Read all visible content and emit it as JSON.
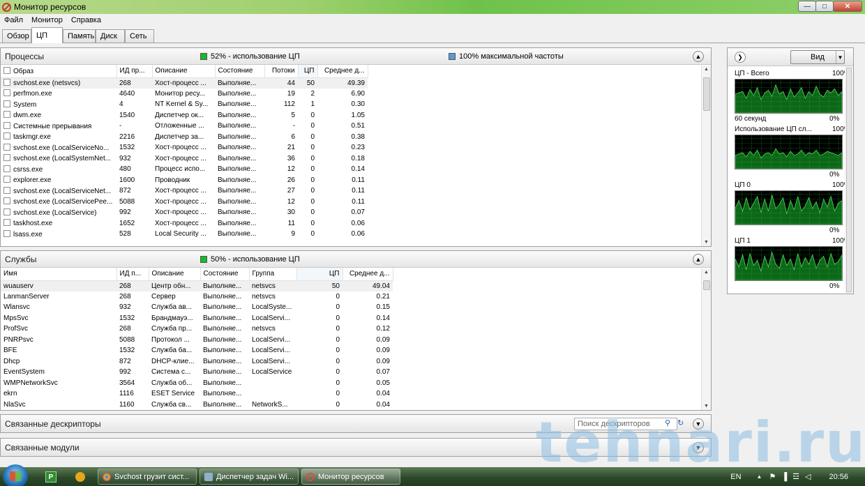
{
  "window": {
    "title": "Монитор ресурсов"
  },
  "menu": [
    "Файл",
    "Монитор",
    "Справка"
  ],
  "tabs": [
    "Обзор",
    "ЦП",
    "Память",
    "Диск",
    "Сеть"
  ],
  "processes": {
    "title": "Процессы",
    "cpu_usage_label": "52% - использование ЦП",
    "freq_label": "100% максимальной частоты",
    "usage_color": "#19b92e",
    "freq_color": "#5b9bd5",
    "columns": [
      "Образ",
      "ИД пр...",
      "Описание",
      "Состояние",
      "Потоки",
      "ЦП",
      "Среднее д..."
    ],
    "rows": [
      [
        "svchost.exe (netsvcs)",
        "268",
        "Хост-процесс ...",
        "Выполняе...",
        "44",
        "50",
        "49.39"
      ],
      [
        "perfmon.exe",
        "4640",
        "Монитор ресу...",
        "Выполняе...",
        "19",
        "2",
        "6.90"
      ],
      [
        "System",
        "4",
        "NT Kernel & Sy...",
        "Выполняе...",
        "112",
        "1",
        "0.30"
      ],
      [
        "dwm.exe",
        "1540",
        "Диспетчер ок...",
        "Выполняе...",
        "5",
        "0",
        "1.05"
      ],
      [
        "Системные прерывания",
        "-",
        "Отложенные ...",
        "Выполняе...",
        "-",
        "0",
        "0.51"
      ],
      [
        "taskmgr.exe",
        "2216",
        "Диспетчер за...",
        "Выполняе...",
        "6",
        "0",
        "0.38"
      ],
      [
        "svchost.exe (LocalServiceNo...",
        "1532",
        "Хост-процесс ...",
        "Выполняе...",
        "21",
        "0",
        "0.23"
      ],
      [
        "svchost.exe (LocalSystemNet...",
        "932",
        "Хост-процесс ...",
        "Выполняе...",
        "36",
        "0",
        "0.18"
      ],
      [
        "csrss.exe",
        "480",
        "Процесс испо...",
        "Выполняе...",
        "12",
        "0",
        "0.14"
      ],
      [
        "explorer.exe",
        "1600",
        "Проводник",
        "Выполняе...",
        "26",
        "0",
        "0.11"
      ],
      [
        "svchost.exe (LocalServiceNet...",
        "872",
        "Хост-процесс ...",
        "Выполняе...",
        "27",
        "0",
        "0.11"
      ],
      [
        "svchost.exe (LocalServicePee...",
        "5088",
        "Хост-процесс ...",
        "Выполняе...",
        "12",
        "0",
        "0.11"
      ],
      [
        "svchost.exe (LocalService)",
        "992",
        "Хост-процесс ...",
        "Выполняе...",
        "30",
        "0",
        "0.07"
      ],
      [
        "taskhost.exe",
        "1652",
        "Хост-процесс ...",
        "Выполняе...",
        "11",
        "0",
        "0.06"
      ],
      [
        "lsass.exe",
        "528",
        "Local Security ...",
        "Выполняе...",
        "9",
        "0",
        "0.06"
      ]
    ]
  },
  "services": {
    "title": "Службы",
    "cpu_usage_label": "50% - использование ЦП",
    "columns": [
      "Имя",
      "ИД п...",
      "Описание",
      "Состояние",
      "Группа",
      "ЦП",
      "Среднее д..."
    ],
    "rows": [
      [
        "wuauserv",
        "268",
        "Центр обн...",
        "Выполняе...",
        "netsvcs",
        "50",
        "49.04"
      ],
      [
        "LanmanServer",
        "268",
        "Сервер",
        "Выполняе...",
        "netsvcs",
        "0",
        "0.21"
      ],
      [
        "Wlansvc",
        "932",
        "Служба ав...",
        "Выполняе...",
        "LocalSyste...",
        "0",
        "0.15"
      ],
      [
        "MpsSvc",
        "1532",
        "Брандмауэ...",
        "Выполняе...",
        "LocalServi...",
        "0",
        "0.14"
      ],
      [
        "ProfSvc",
        "268",
        "Служба пр...",
        "Выполняе...",
        "netsvcs",
        "0",
        "0.12"
      ],
      [
        "PNRPsvc",
        "5088",
        "Протокол ...",
        "Выполняе...",
        "LocalServi...",
        "0",
        "0.09"
      ],
      [
        "BFE",
        "1532",
        "Служба ба...",
        "Выполняе...",
        "LocalServi...",
        "0",
        "0.09"
      ],
      [
        "Dhcp",
        "872",
        "DHCP-клие...",
        "Выполняе...",
        "LocalServi...",
        "0",
        "0.09"
      ],
      [
        "EventSystem",
        "992",
        "Система с...",
        "Выполняе...",
        "LocalService",
        "0",
        "0.07"
      ],
      [
        "WMPNetworkSvc",
        "3564",
        "Служба об...",
        "Выполняе...",
        "",
        "0",
        "0.05"
      ],
      [
        "ekrn",
        "1116",
        "ESET Service",
        "Выполняе...",
        "",
        "0",
        "0.04"
      ],
      [
        "NlaSvc",
        "1160",
        "Служба св...",
        "Выполняе...",
        "NetworkS...",
        "0",
        "0.04"
      ]
    ]
  },
  "handles": {
    "title": "Связанные дескрипторы",
    "search_placeholder": "Поиск дескрипторов"
  },
  "modules": {
    "title": "Связанные модули"
  },
  "right_pane": {
    "view_label": "Вид",
    "graph_color": "#19b92e",
    "graphs": [
      {
        "title": "ЦП - Всего",
        "max": "100%",
        "min": "0%",
        "footer": "60 секунд"
      },
      {
        "title": "Использование ЦП сл...",
        "max": "100%",
        "min": "0%"
      },
      {
        "title": "ЦП 0",
        "max": "100%",
        "min": "0%"
      },
      {
        "title": "ЦП 1",
        "max": "100%",
        "min": "0%"
      }
    ]
  },
  "taskbar": {
    "items": [
      "Svchost грузит сист...",
      "Диспетчер задач Wi...",
      "Монитор ресурсов"
    ],
    "language": "EN",
    "time": "20:56"
  },
  "watermark": "tehnari.ru"
}
